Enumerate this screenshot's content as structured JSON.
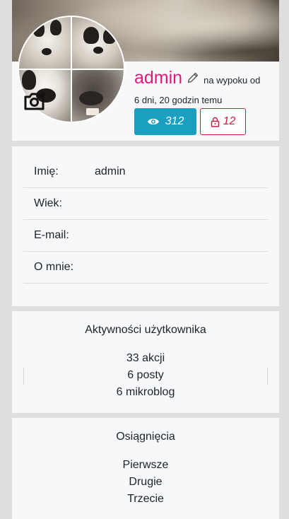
{
  "profile": {
    "username": "admin",
    "since_label": "na wypoku od",
    "since_time": "6 dni, 20 godzin temu",
    "views_count": "312",
    "locked_count": "12"
  },
  "info": {
    "rows": [
      {
        "label": "Imię:",
        "value": "admin"
      },
      {
        "label": "Wiek:",
        "value": ""
      },
      {
        "label": "E-mail:",
        "value": ""
      },
      {
        "label": "O mnie:",
        "value": ""
      }
    ]
  },
  "activity": {
    "title": "Aktywności użytkownika",
    "items": [
      "33 akcji",
      "6 posty",
      "6 mikroblog"
    ]
  },
  "achievements": {
    "title": "Osiągnięcia",
    "items": [
      "Pierwsze",
      "Drugie",
      "Trzecie"
    ]
  },
  "colors": {
    "username": "#e6177a",
    "views_button": "#1b9fc1",
    "locked_button": "#d4183f"
  },
  "icons": [
    "camera-plus-icon",
    "pencil-icon",
    "eye-icon",
    "lock-icon"
  ]
}
